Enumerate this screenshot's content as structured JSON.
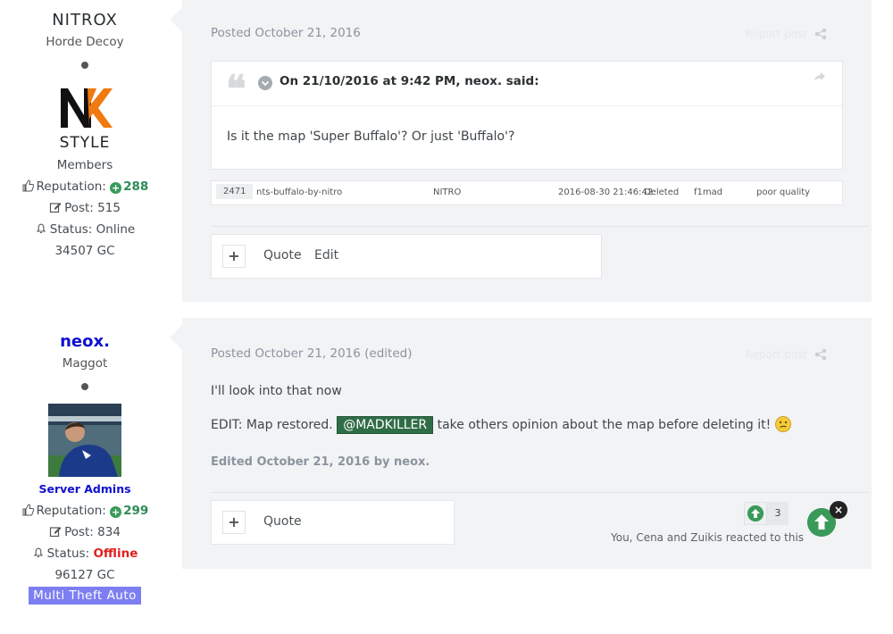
{
  "posts": [
    {
      "author": {
        "name": "NITROX",
        "title": "Horde Decoy",
        "avatar_text": "STYLE",
        "group": "Members",
        "rep_label": "Reputation:",
        "rep_value": "288",
        "post_label": "Post: 515",
        "status_label": "Status:",
        "status_value": "Online",
        "gc": "34507 GC"
      },
      "meta": {
        "posted_label": "Posted",
        "date": "October 21, 2016",
        "edited_tag": ""
      },
      "report": "Report post",
      "quote": {
        "cite": "On 21/10/2016 at 9:42 PM, neox. said:",
        "text": "Is it the map 'Super Buffalo'? Or just 'Buffalo'?"
      },
      "map_row": {
        "id": "2471",
        "resource": "nts-buffalo-by-nitro",
        "author": "NITRO",
        "date": "2016-08-30 21:46:42",
        "state": "Deleted",
        "user": "f1mad",
        "reason": "poor quality"
      },
      "actions": {
        "plus": "+",
        "quote": "Quote",
        "edit": "Edit"
      }
    },
    {
      "author": {
        "name": "neox.",
        "title": "Maggot",
        "group": "Server Admins",
        "rep_label": "Reputation:",
        "rep_value": "299",
        "post_label": "Post: 834",
        "status_label": "Status:",
        "status_value": "Offline",
        "gc": "96127 GC",
        "badge": "Multi Theft Auto"
      },
      "meta": {
        "posted_label": "Posted",
        "date": "October 21, 2016",
        "edited_tag": "(edited)"
      },
      "report": "Report post",
      "body": {
        "line1": "I'll look into that now",
        "line2_pre": "EDIT: Map restored.",
        "mention": "@MADKILLER",
        "line2_post": "take others opinion about the map before deleting it!"
      },
      "edited_note": "Edited October 21, 2016 by neox.",
      "actions": {
        "plus": "+",
        "quote": "Quote"
      },
      "reactions": {
        "count": "3",
        "text": "You, Cena and Zuikis reacted to this"
      },
      "close_label": "×"
    }
  ],
  "colors": {
    "accent_green": "#3a9a5a",
    "offline_red": "#e02020",
    "admin_blue": "#1010d0",
    "badge_purple": "#7d7ef2",
    "mention_green": "#2f6d47"
  }
}
